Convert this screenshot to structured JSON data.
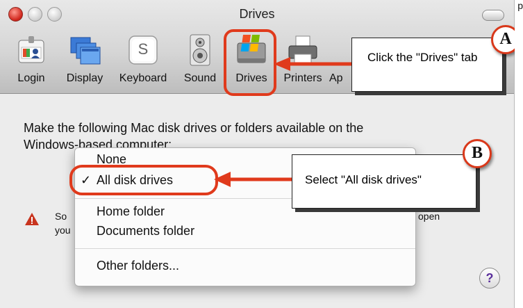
{
  "window": {
    "title": "Drives"
  },
  "toolbar": {
    "items": [
      {
        "label": "Login"
      },
      {
        "label": "Display"
      },
      {
        "label": "Keyboard"
      },
      {
        "label": "Sound"
      },
      {
        "label": "Drives"
      },
      {
        "label": "Printers"
      },
      {
        "label": "Ap"
      }
    ],
    "keyboard_key_glyph": "S"
  },
  "annotations": {
    "a_badge": "A",
    "a_text": "Click the \"Drives\" tab",
    "b_badge": "B",
    "b_text": "Select \"All disk drives\"",
    "accent_color": "#e03a1c"
  },
  "content": {
    "instruction_line1": "Make the following Mac disk drives or folders available on the",
    "instruction_line2": "Windows-based computer:",
    "warning_line1_start": "So",
    "warning_line1_end": "open",
    "warning_line2_start": "you"
  },
  "dropdown": {
    "items": [
      {
        "label": "None",
        "checked": false
      },
      {
        "label": "All disk drives",
        "checked": true
      },
      {
        "label": "Home folder",
        "checked": false
      },
      {
        "label": "Documents folder",
        "checked": false
      },
      {
        "label": "Other folders...",
        "checked": false
      }
    ],
    "checkmark": "✓"
  },
  "help": {
    "glyph": "?"
  },
  "edge_fragment": "p"
}
